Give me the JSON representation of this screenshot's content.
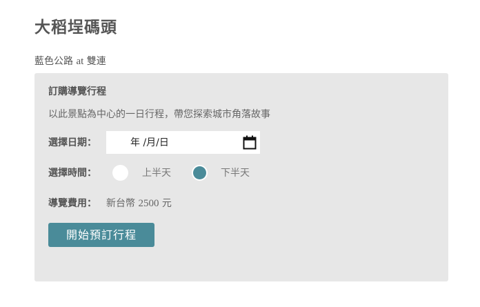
{
  "page": {
    "title": "大稻埕碼頭",
    "subtitle_route": "藍色公路",
    "subtitle_at": "at",
    "subtitle_place": "雙連"
  },
  "booking": {
    "heading": "訂購導覽行程",
    "description": "以此景點為中心的一日行程，帶您探索城市角落故事",
    "date_label": "選擇日期：",
    "date_placeholder": "年 /月/日",
    "time_label": "選擇時間：",
    "time_options": [
      {
        "label": "上半天",
        "selected": false
      },
      {
        "label": "下半天",
        "selected": true
      }
    ],
    "fee_label": "導覽費用：",
    "fee_prefix": "新台幣",
    "fee_amount": "2500",
    "fee_unit": "元",
    "submit_label": "開始預訂行程"
  },
  "colors": {
    "accent": "#4a8b99",
    "panel_bg": "#e7e7e7",
    "text": "#555555"
  },
  "icons": {
    "date_picker": "calendar-icon"
  }
}
